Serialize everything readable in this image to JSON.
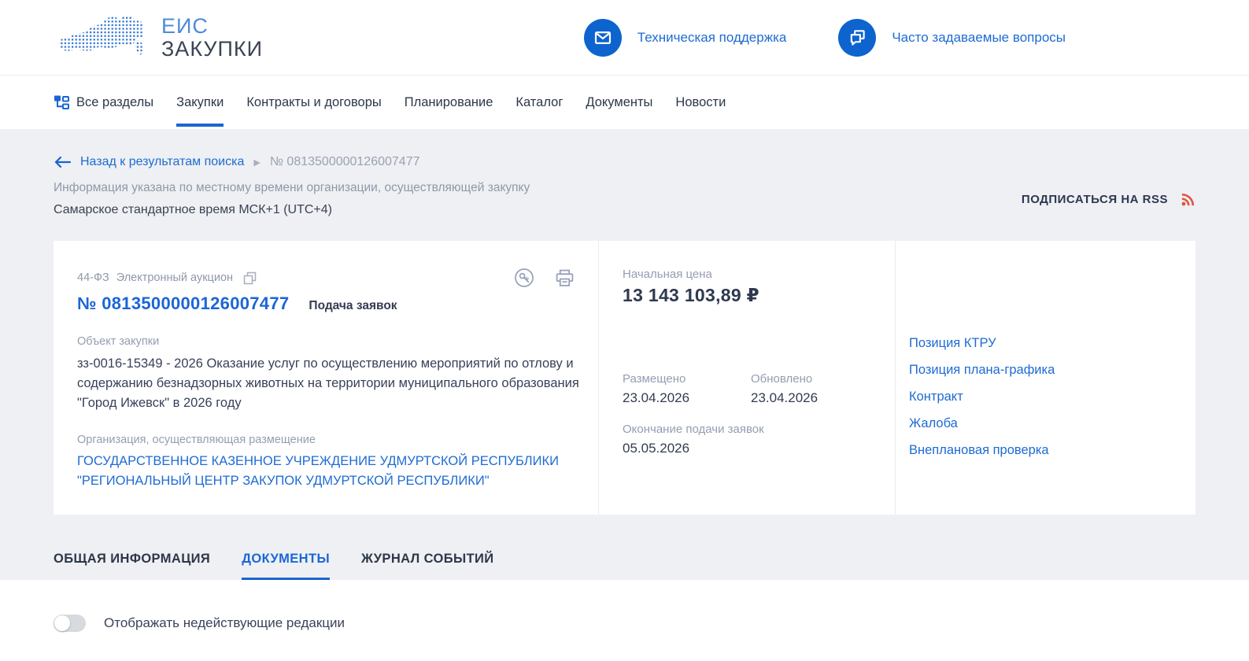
{
  "brand": {
    "line1": "ЕИС",
    "line2": "ЗАКУПКИ"
  },
  "header": {
    "support_label": "Техническая поддержка",
    "faq_label": "Часто задаваемые вопросы"
  },
  "nav": {
    "items": [
      {
        "label": "Все разделы"
      },
      {
        "label": "Закупки",
        "active": true
      },
      {
        "label": "Контракты и договоры"
      },
      {
        "label": "Планирование"
      },
      {
        "label": "Каталог"
      },
      {
        "label": "Документы"
      },
      {
        "label": "Новости"
      }
    ]
  },
  "breadcrumb": {
    "back_label": "Назад к результатам поиска",
    "current": "№ 0813500000126007477"
  },
  "timezone": {
    "note": "Информация указана по местному времени организации, осуществляющей закупку",
    "value": "Самарское стандартное время МСК+1 (UTC+4)"
  },
  "rss": {
    "label": "ПОДПИСАТЬСЯ НА RSS"
  },
  "purchase": {
    "law": "44-ФЗ",
    "method": "Электронный аукцион",
    "number": "№ 0813500000126007477",
    "status": "Подача заявок",
    "object_label": "Объект закупки",
    "object_text": "зз-0016-15349 - 2026 Оказание услуг по осуществлению мероприятий по отлову и содержанию безнадзорных животных на территории муниципального образования \"Город Ижевск\" в 2026 году",
    "org_label": "Организация, осуществляющая размещение",
    "org_name": "ГОСУДАРСТВЕННОЕ КАЗЕННОЕ УЧРЕЖДЕНИЕ УДМУРТСКОЙ РЕСПУБЛИКИ \"РЕГИОНАЛЬНЫЙ ЦЕНТР ЗАКУПОК УДМУРТСКОЙ РЕСПУБЛИКИ\"",
    "price_label": "Начальная цена",
    "price": "13 143 103,89 ₽",
    "placed_label": "Размещено",
    "placed": "23.04.2026",
    "updated_label": "Обновлено",
    "updated": "23.04.2026",
    "deadline_label": "Окончание подачи заявок",
    "deadline": "05.05.2026"
  },
  "related_links": [
    {
      "label": "Позиция КТРУ"
    },
    {
      "label": "Позиция плана-графика"
    },
    {
      "label": "Контракт"
    },
    {
      "label": "Жалоба"
    },
    {
      "label": "Внеплановая проверка"
    }
  ],
  "tabs": [
    {
      "label": "ОБЩАЯ ИНФОРМАЦИЯ"
    },
    {
      "label": "ДОКУМЕНТЫ",
      "active": true
    },
    {
      "label": "ЖУРНАЛ СОБЫТИЙ"
    }
  ],
  "toggle": {
    "label": "Отображать недействующие редакции",
    "state": "off"
  },
  "colors": {
    "link_blue": "#1e6bd3",
    "accent_blue": "#1a64d2",
    "circle_blue": "#0d64cf",
    "dark_text": "#333c51",
    "gray_label": "#949db0",
    "page_gray": "#eef0f3",
    "rss_orange": "#e0523e"
  }
}
